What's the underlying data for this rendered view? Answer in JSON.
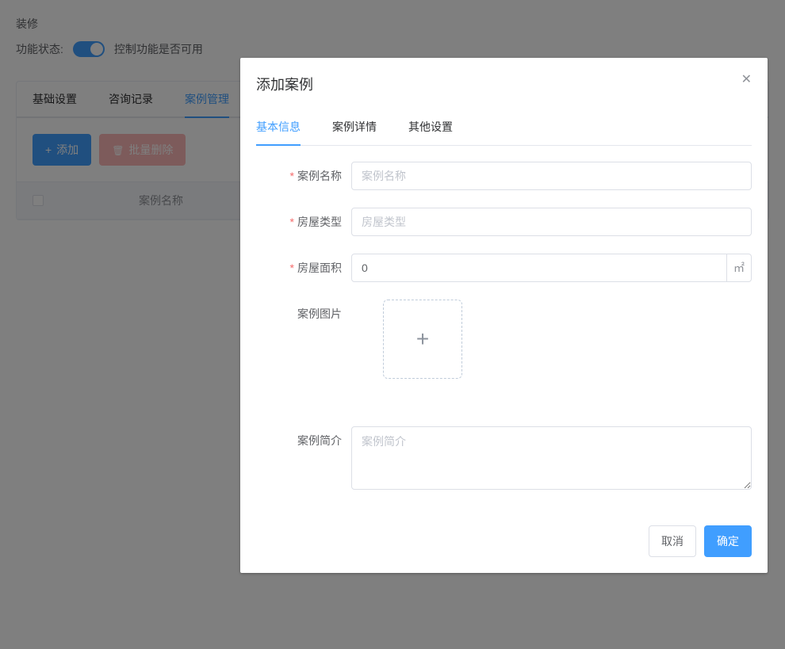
{
  "background": {
    "title": "装修",
    "status_label": "功能状态:",
    "status_desc": "控制功能是否可用",
    "tabs": {
      "basic": "基础设置",
      "consult": "咨询记录",
      "cases": "案例管理"
    },
    "toolbar": {
      "add": "添加",
      "batch_delete": "批量删除"
    },
    "table": {
      "col_name": "案例名称"
    }
  },
  "dialog": {
    "title": "添加案例",
    "tabs": {
      "basic": "基本信息",
      "detail": "案例详情",
      "other": "其他设置"
    },
    "labels": {
      "case_name": "案例名称",
      "house_type": "房屋类型",
      "house_area": "房屋面积",
      "case_image": "案例图片",
      "case_intro": "案例简介"
    },
    "placeholders": {
      "case_name": "案例名称",
      "house_type": "房屋类型",
      "case_intro": "案例简介"
    },
    "values": {
      "house_area": "0"
    },
    "area_unit": "㎡",
    "footer": {
      "cancel": "取消",
      "confirm": "确定"
    }
  }
}
